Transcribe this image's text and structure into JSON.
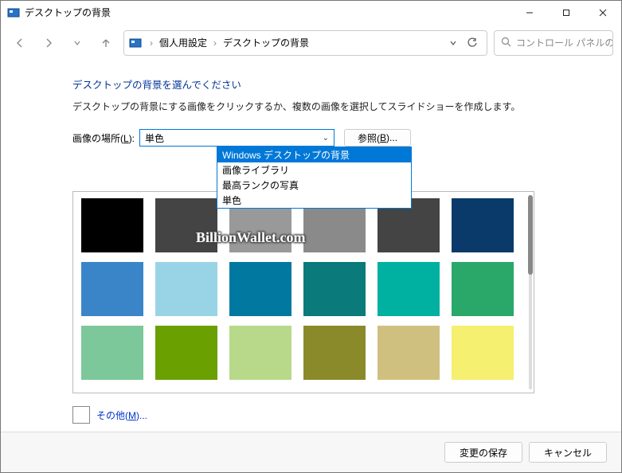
{
  "window": {
    "title": "デスクトップの背景"
  },
  "breadcrumb": {
    "item1": "個人用設定",
    "item2": "デスクトップの背景"
  },
  "search": {
    "placeholder": "コントロール パネルの..."
  },
  "header": {
    "title": "デスクトップの背景を選んでください",
    "subtext": "デスクトップの背景にする画像をクリックするか、複数の画像を選択してスライドショーを作成します。"
  },
  "controls": {
    "location_label_pre": "画像の場所(",
    "location_label_hotkey": "L",
    "location_label_post": "):",
    "selected": "単色",
    "browse_label_pre": "参照(",
    "browse_label_hotkey": "B",
    "browse_label_post": ")..."
  },
  "dropdown": {
    "items": [
      "Windows デスクトップの背景",
      "画像ライブラリ",
      "最高ランクの写真",
      "単色"
    ],
    "selected_index": 0
  },
  "colors": [
    "#000000",
    "#444444",
    "#999999",
    "#8a8a8a",
    "#444444",
    "#0a3a6a",
    "#3a85c8",
    "#99d4e6",
    "#0078a0",
    "#0a7a7a",
    "#00b0a0",
    "#2aa86a",
    "#7cc89a",
    "#6aa000",
    "#b8d98a",
    "#8a8a2a",
    "#d0c080",
    "#f5f070"
  ],
  "other": {
    "label_pre": "その他(",
    "hotkey": "M",
    "label_post": ")..."
  },
  "buttons": {
    "save": "変更の保存",
    "cancel": "キャンセル"
  },
  "watermark": "BillionWallet.com"
}
